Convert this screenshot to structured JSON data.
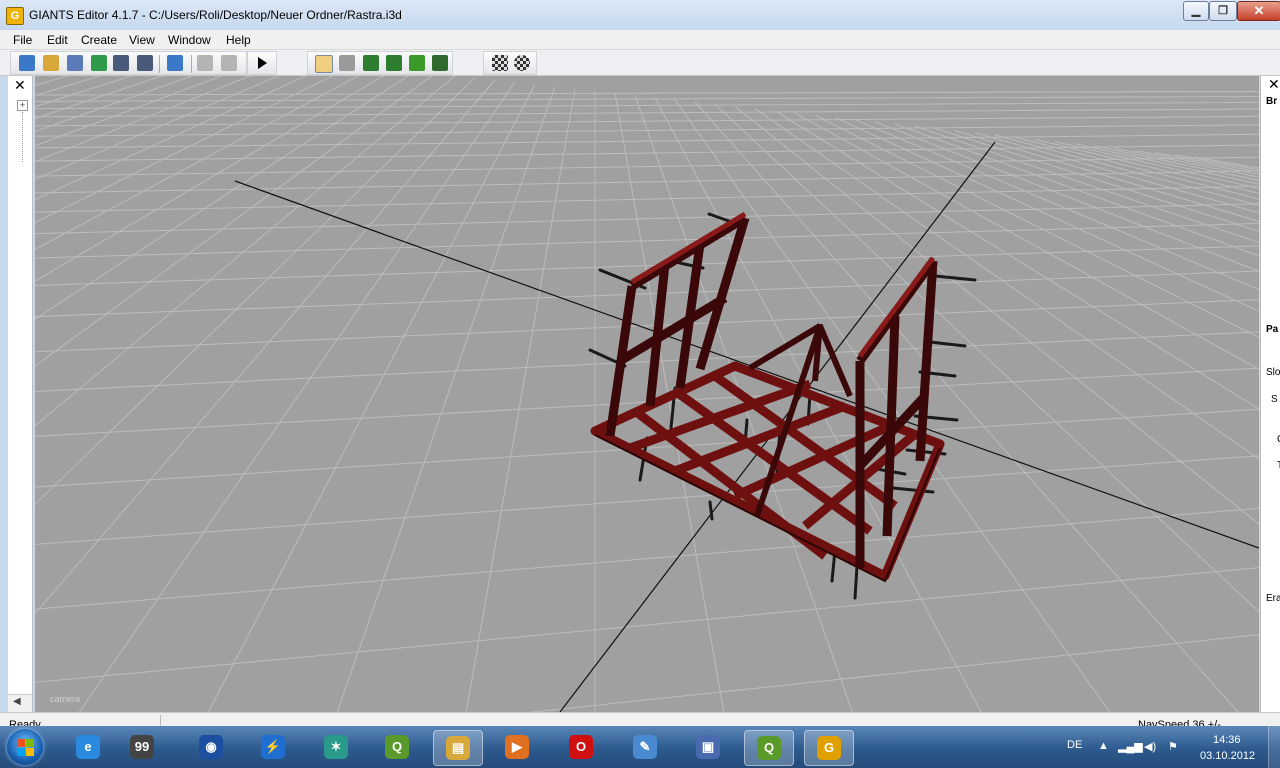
{
  "window": {
    "app_icon_letter": "G",
    "title": "GIANTS Editor 4.1.7 - C:/Users/Roli/Desktop/Neuer Ordner/Rastra.i3d",
    "controls": {
      "minimize": "minimize-icon",
      "maximize": "maximize-icon",
      "close": "close-icon"
    }
  },
  "menu": {
    "items": [
      {
        "label": "File"
      },
      {
        "label": "Edit"
      },
      {
        "label": "Create"
      },
      {
        "label": "View"
      },
      {
        "label": "Window"
      },
      {
        "label": "Help"
      }
    ]
  },
  "toolbar": {
    "buttons": [
      "new-scene-icon",
      "open-icon",
      "list-icon",
      "refresh-icon",
      "save-icon",
      "save-as-icon",
      "import-icon",
      "undo-icon",
      "redo-icon",
      "play-icon",
      "home-view-icon",
      "select-tool-icon",
      "terrain-sculpt-icon",
      "terrain-paint-icon",
      "foliage-paint-icon",
      "terrain-extra-icon",
      "checker-icon",
      "checker-settings-icon"
    ],
    "colors": {
      "icon_blue": "#3c78c8",
      "icon_green": "#2f7d2f",
      "play": "#000000"
    }
  },
  "scenegraph": {
    "close_glyph": "✕",
    "expand_glyph": "+"
  },
  "viewport": {
    "camera_label": "camera",
    "background": "#a0a0a0",
    "grid_color": "#bcbcbc",
    "object_color": "#7a1212"
  },
  "attributes_panel": {
    "close_glyph": "✕",
    "labels": [
      "Br",
      "Pa",
      "Slo",
      "S",
      "C",
      "T",
      "Era"
    ]
  },
  "status": {
    "left": "Ready",
    "right": "NavSpeed 36 +/-"
  },
  "taskbar": {
    "apps": [
      {
        "name": "internet-explorer-icon",
        "glyph": "e",
        "color": "#2a8ae0"
      },
      {
        "name": "monitoring-icon",
        "glyph": "99",
        "color": "#444444"
      },
      {
        "name": "globe-icon",
        "glyph": "◉",
        "color": "#1d4fa0"
      },
      {
        "name": "lightning-icon",
        "glyph": "⚡",
        "color": "#1f6fd0"
      },
      {
        "name": "star-tool-icon",
        "glyph": "✶",
        "color": "#2a9a8a"
      },
      {
        "name": "qgis-icon",
        "glyph": "Q",
        "color": "#5a9a2a"
      },
      {
        "name": "file-explorer-icon",
        "glyph": "▤",
        "color": "#d8a83a"
      },
      {
        "name": "media-player-icon",
        "glyph": "▶",
        "color": "#e07020"
      },
      {
        "name": "opera-icon",
        "glyph": "O",
        "color": "#d01010"
      },
      {
        "name": "paint-icon",
        "glyph": "✎",
        "color": "#4a8ad0"
      },
      {
        "name": "remote-desktop-icon",
        "glyph": "▣",
        "color": "#4a6ab0"
      },
      {
        "name": "qgis-active-icon",
        "glyph": "Q",
        "color": "#5a9a2a"
      },
      {
        "name": "giants-editor-icon",
        "glyph": "G",
        "color": "#e0a000"
      }
    ],
    "tray": {
      "language": "DE",
      "time": "14:36",
      "date": "03.10.2012"
    }
  }
}
